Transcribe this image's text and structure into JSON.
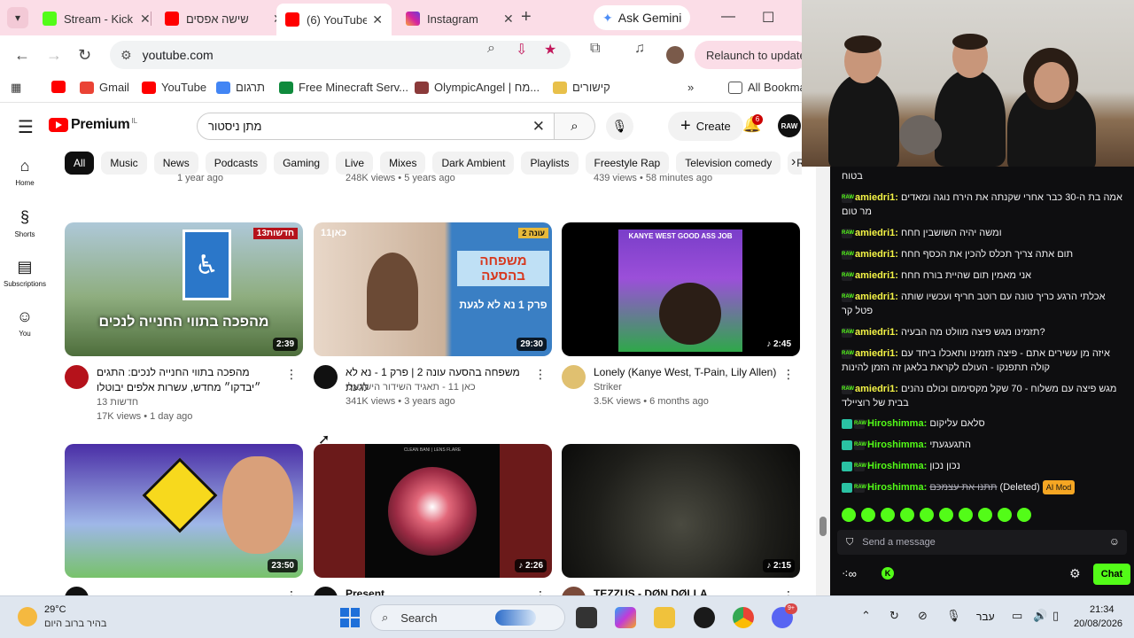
{
  "browser": {
    "tabs": [
      {
        "title": "Stream - Kick",
        "active": false,
        "color": "#53fc18"
      },
      {
        "title": "שישה אפסים",
        "active": false,
        "color": "#ff0000"
      },
      {
        "title": "(6) YouTube",
        "active": true,
        "color": "#ff0000"
      },
      {
        "title": "Instagram",
        "active": false,
        "color": "#d6249f"
      }
    ],
    "gemini_label": "Ask Gemini",
    "url": "youtube.com",
    "relaunch_label": "Relaunch to update",
    "bookmarks": [
      {
        "label": "",
        "color": "#ff0000"
      },
      {
        "label": "Gmail",
        "color": "#ea4335"
      },
      {
        "label": "YouTube",
        "color": "#ff0000"
      },
      {
        "label": "תרגום",
        "color": "#4285f4"
      },
      {
        "label": "Free Minecraft Serv...",
        "color": "#0f8a3c"
      },
      {
        "label": "OlympicAngel | מח...",
        "color": "#8b3a3a"
      },
      {
        "label": "קישורים",
        "color": "#e8c04a"
      }
    ],
    "all_bookmarks_label": "All Bookmarks"
  },
  "youtube": {
    "logo_text": "Premium",
    "logo_country": "IL",
    "search_value": "מתן ניסטור",
    "create_label": "Create",
    "notifications_count": "6",
    "avatar_text": "RAW",
    "chips": [
      "All",
      "Music",
      "News",
      "Podcasts",
      "Gaming",
      "Live",
      "Mixes",
      "Dark Ambient",
      "Playlists",
      "Freestyle Rap",
      "Television comedy",
      "Rapping"
    ],
    "guide": [
      {
        "label": "Home",
        "icon": "home-icon"
      },
      {
        "label": "Shorts",
        "icon": "shorts-icon"
      },
      {
        "label": "Subscriptions",
        "icon": "subscriptions-icon"
      },
      {
        "label": "You",
        "icon": "you-icon"
      }
    ],
    "top_row_meta": [
      "1 year ago",
      "248K views • 5 years ago",
      "439 views • 58 minutes ago"
    ],
    "videos": [
      {
        "title": "מהפכה בתווי החנייה לנכים: התגים ״יבדקו״ מחדש, עשרות אלפים יבוטלו",
        "channel": "חדשות 13",
        "stats": "17K views • 1 day ago",
        "duration": "2:39",
        "thumb_text": "מהפכה בתווי החנייה לנכים",
        "thumb_badge": "חדשות13",
        "avatar_color": "#b5121b"
      },
      {
        "title": "משפחה בהסעה עונה 2 | פרק 1 - נא לא לגעת",
        "channel": "כאן 11 - תאגיד השידור הישראלי",
        "stats": "341K views • 3 years ago",
        "duration": "29:30",
        "thumb_text": "משפחה בהסעה",
        "thumb_sub": "פרק 1 נא לא לגעת",
        "thumb_badge": "עונה 2",
        "thumb_logo": "כאן11",
        "avatar_color": "#111111"
      },
      {
        "title": "Lonely (Kanye West, T-Pain, Lily Allen)",
        "channel": "Striker",
        "stats": "3.5K views • 6 months ago",
        "duration": "2:45",
        "thumb_text": "KANYE WEST GOOD ASS JOB",
        "avatar_color": "#e0c070"
      },
      {
        "title": "",
        "channel": "",
        "stats": "",
        "duration": "23:50",
        "avatar_color": "#111111"
      },
      {
        "title": "Present",
        "channel": "",
        "stats": "",
        "duration": "2:26",
        "thumb_text": "CLEAN BANI | LENS FLARE",
        "avatar_color": "#111111"
      },
      {
        "title": "TEZZUS - DØN DØLLA",
        "channel": "",
        "stats": "",
        "duration": "2:15",
        "avatar_color": "#7a4a3a"
      }
    ]
  },
  "chat": {
    "top_fragment": "בטוח",
    "messages": [
      {
        "user": "amiedri1:",
        "text": "אמה בת ה-30 כבר אחרי שקנתה את הירח נוגה ומאדים מר טום",
        "user_color": "#f5f546"
      },
      {
        "user": "amiedri1:",
        "text": "ומשה יהיה השושבין חחח",
        "user_color": "#f5f546"
      },
      {
        "user": "amiedri1:",
        "text": "תום אתה צריך תכלס להכין את הכסף חחח",
        "user_color": "#f5f546"
      },
      {
        "user": "amiedri1:",
        "text": "אני מאמין תום שהיית בורח חחח",
        "user_color": "#f5f546"
      },
      {
        "user": "amiedri1:",
        "text": "אכלתי הרגע כריך טונה עם רוטב חריף ועכשיו שותה פטל קר",
        "user_color": "#f5f546"
      },
      {
        "user": "amiedri1:",
        "text": "תזמינו מגש פיצה מוולט מה הבעיה?",
        "user_color": "#f5f546"
      },
      {
        "user": "amiedri1:",
        "text": "איזה מן עשירים אתם - פיצה תזמינו ותאכלו ביחד עם קולה תתפנקו - העולם לקראת בלאגן זה הזמן להינות",
        "user_color": "#f5f546"
      },
      {
        "user": "amiedri1:",
        "text": "מגש פיצה עם משלוח - 70 שקל מקסימום וכולם נהנים בבית של רוציילד",
        "user_color": "#f5f546"
      },
      {
        "user": "Hiroshimma:",
        "text": "סלאם עליקום",
        "user_color": "#53fc18"
      },
      {
        "user": "Hiroshimma:",
        "text": "התגעגעתי",
        "user_color": "#53fc18"
      },
      {
        "user": "Hiroshimma:",
        "text": "נכון נכון",
        "user_color": "#53fc18"
      },
      {
        "user": "Hiroshimma:",
        "text": "תתנו את עצמכם",
        "deleted_label": "(Deleted)",
        "mod_label": "AI Mod",
        "user_color": "#53fc18"
      }
    ],
    "input_placeholder": "Send a message",
    "chat_button": "Chat",
    "kick_glyph": "K"
  },
  "taskbar": {
    "temperature": "29°C",
    "weather_desc": "בהיר ברוב היום",
    "search_label": "Search",
    "discord_badge": "9+",
    "language": "עבר",
    "time": "21:34",
    "date": "20/08/2026"
  }
}
